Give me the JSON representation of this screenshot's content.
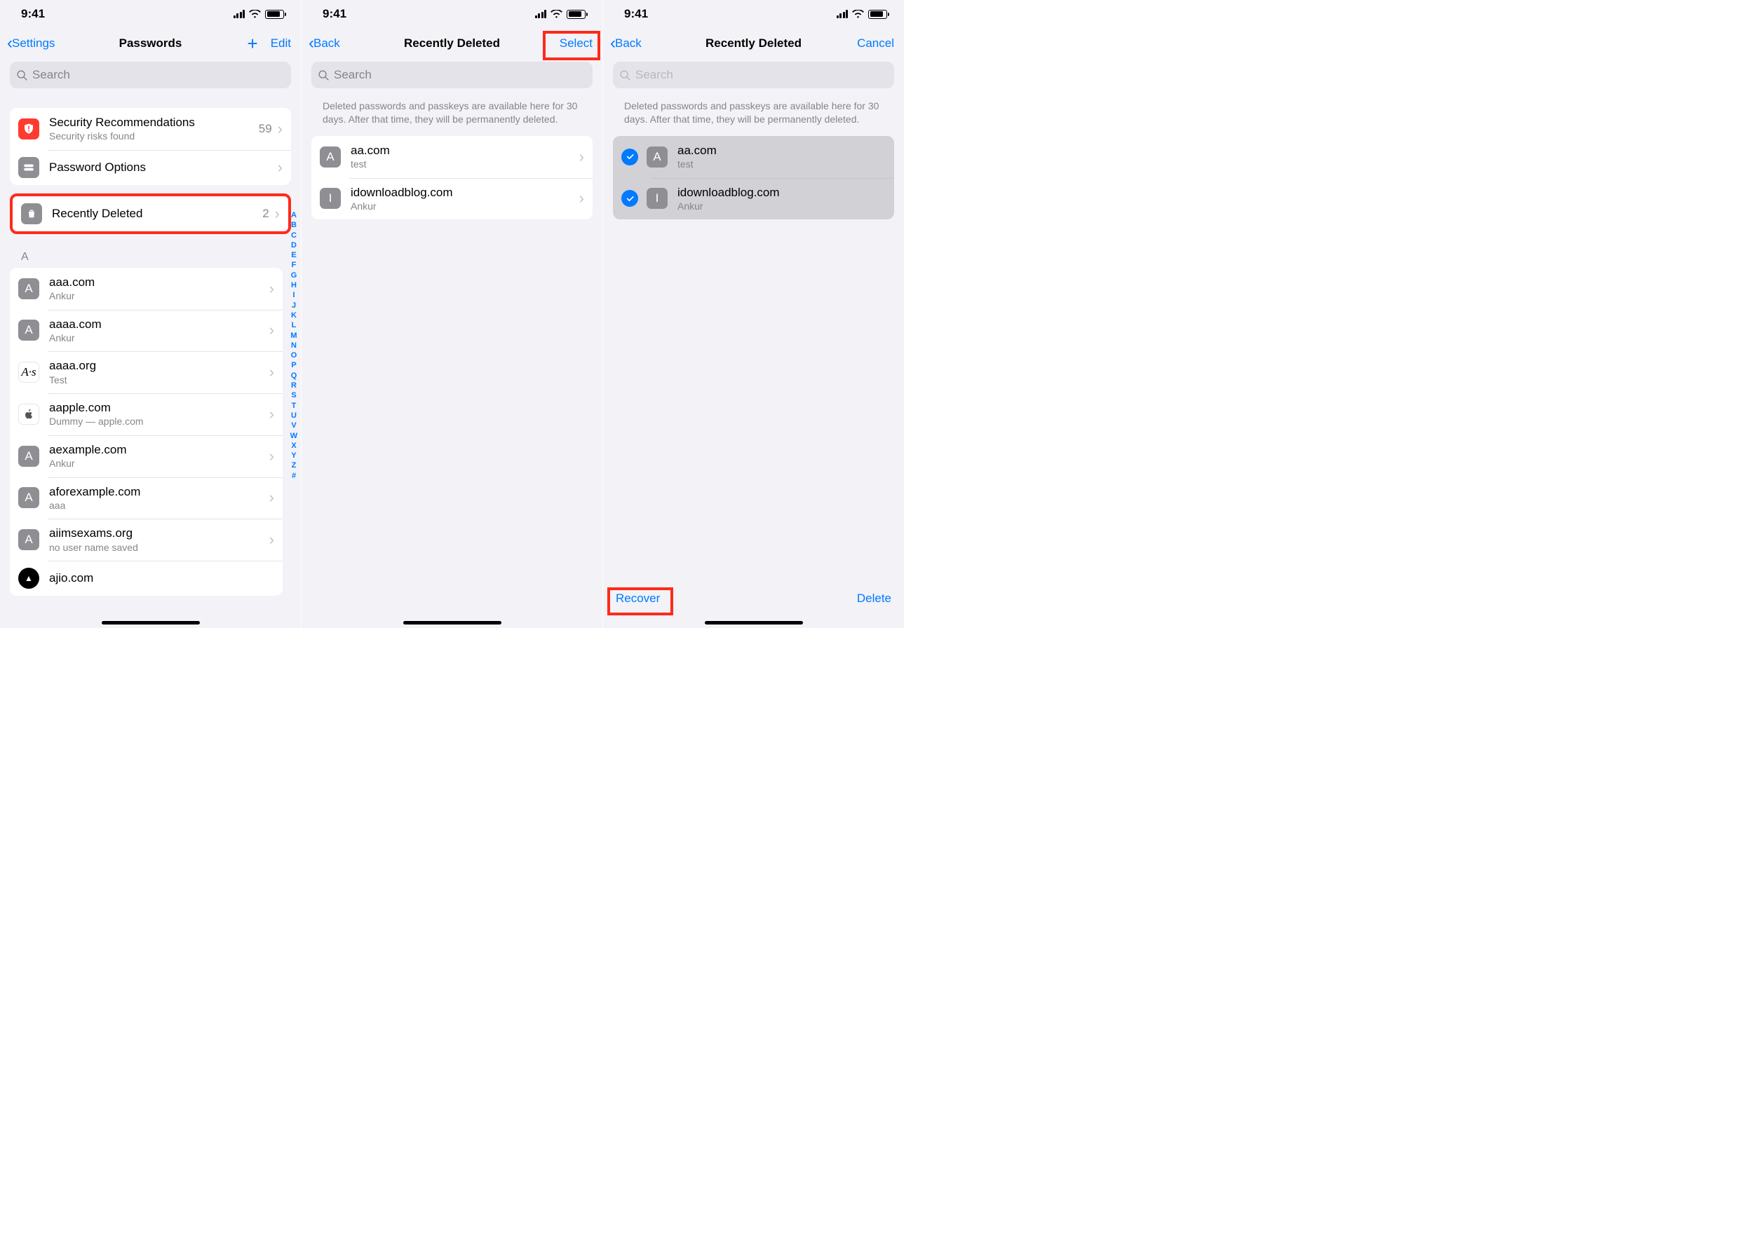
{
  "status": {
    "time": "9:41"
  },
  "screen1": {
    "nav": {
      "back": "Settings",
      "title": "Passwords",
      "edit": "Edit"
    },
    "search_placeholder": "Search",
    "top_rows": [
      {
        "icon": "shield",
        "title": "Security Recommendations",
        "sub": "Security risks found",
        "count": "59"
      },
      {
        "icon": "key",
        "title": "Password Options"
      },
      {
        "icon": "trash",
        "title": "Recently Deleted",
        "count": "2",
        "highlight": true
      }
    ],
    "section_letter": "A",
    "passwords": [
      {
        "letter": "A",
        "title": "aaa.com",
        "sub": "Ankur"
      },
      {
        "letter": "A",
        "title": "aaaa.com",
        "sub": "Ankur"
      },
      {
        "icon_style": "ital",
        "letter": "A·s",
        "title": "aaaa.org",
        "sub": "Test"
      },
      {
        "icon_style": "apple",
        "title": "aapple.com",
        "sub": "Dummy — apple.com"
      },
      {
        "letter": "A",
        "title": "aexample.com",
        "sub": "Ankur"
      },
      {
        "letter": "A",
        "title": "aforexample.com",
        "sub": "aaa"
      },
      {
        "letter": "A",
        "title": "aiimsexams.org",
        "sub": "no user name saved"
      },
      {
        "icon_style": "black",
        "letter": "▲",
        "title": "ajio.com",
        "sub": ""
      }
    ],
    "index_letters": [
      "A",
      "B",
      "C",
      "D",
      "E",
      "F",
      "G",
      "H",
      "I",
      "J",
      "K",
      "L",
      "M",
      "N",
      "O",
      "P",
      "Q",
      "R",
      "S",
      "T",
      "U",
      "V",
      "W",
      "X",
      "Y",
      "Z",
      "#"
    ]
  },
  "screen2": {
    "nav": {
      "back": "Back",
      "title": "Recently Deleted",
      "right": "Select"
    },
    "search_placeholder": "Search",
    "info": "Deleted passwords and passkeys are available here for 30 days. After that time, they will be permanently deleted.",
    "rows": [
      {
        "letter": "A",
        "title": "aa.com",
        "sub": "test"
      },
      {
        "letter": "I",
        "title": "idownloadblog.com",
        "sub": "Ankur"
      }
    ]
  },
  "screen3": {
    "nav": {
      "back": "Back",
      "title": "Recently Deleted",
      "right": "Cancel"
    },
    "search_placeholder": "Search",
    "info": "Deleted passwords and passkeys are available here for 30 days. After that time, they will be permanently deleted.",
    "rows": [
      {
        "letter": "A",
        "title": "aa.com",
        "sub": "test"
      },
      {
        "letter": "I",
        "title": "idownloadblog.com",
        "sub": "Ankur"
      }
    ],
    "toolbar": {
      "left": "Recover",
      "right": "Delete"
    }
  }
}
